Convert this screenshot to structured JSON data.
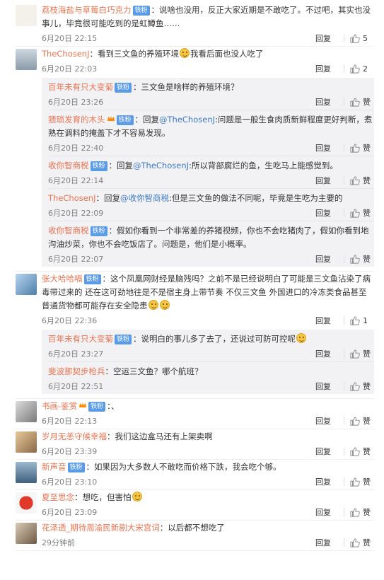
{
  "colors": {
    "name": "#eb7350",
    "mention": "#3d79c4",
    "meta": "#808080",
    "sub_bg": "#f2f2f5",
    "badge": "#5a9be6",
    "vip": "#ff8200"
  },
  "labels": {
    "reply": "回复",
    "like_icon": "thumb-up-icon",
    "verified_badge": "铁粉"
  },
  "comments": [
    {
      "name": "荔枝海盐与草莓白巧克力",
      "badge": "铁粉",
      "text": "：说啥也没用，反正大家近期是不敢吃了。不过吧，其实也没事儿，毕竟很可能吃到的是虹鳟鱼……",
      "time": "6月20日 22:15",
      "reply": "回复",
      "likes": "5"
    },
    {
      "name": "TheChosenJ",
      "text": "：看到三文鱼的养殖环境",
      "text2": "我看后面也没人吃了",
      "time": "6月20日 22:03",
      "reply": "回复",
      "likes": "2",
      "subs": [
        {
          "name": "百年未有只大变菊",
          "badge": "铁粉",
          "text": "：三文鱼是啥样的养殖环境？",
          "time": "6月20日 23:26",
          "reply": "回复",
          "likes": "赞"
        },
        {
          "name": "猥琐发育的木头",
          "badge": "铁粉",
          "pre": "：回复",
          "at": "@TheChosenJ",
          "text": ":问题是一般生食肉质新鲜程度更好判断，煮熟在调料的掩盖下才不容易发现。",
          "time": "6月20日 22:40",
          "reply": "回复",
          "likes": "赞"
        },
        {
          "name": "收你智商税",
          "badge": "铁粉",
          "pre": "：回复",
          "at": "@TheChosenJ",
          "text": ":所以背部腐烂的鱼，生吃马上能感觉到。",
          "time": "6月20日 22:14",
          "reply": "回复",
          "likes": "赞"
        },
        {
          "name": "TheChosenJ",
          "pre": "：回复",
          "at": "@收你智商税",
          "text": ":但是三文鱼的做法不同呢，毕竟是生吃为主要的",
          "time": "6月20日 22:09",
          "reply": "回复",
          "likes": "赞"
        },
        {
          "name": "收你智商税",
          "badge": "铁粉",
          "text": "：假如你看到一个非常差的养猪视频，你也不会吃猪肉了，假如你看到地沟油炒菜，你也不会吃饭店了。问题是，他们是小概率。",
          "time": "6月20日 22:07",
          "reply": "回复",
          "likes": "赞"
        }
      ]
    },
    {
      "name": "张大哈哈嗝",
      "badge": "铁粉",
      "text": "：这个凤凰网财经是脑残吗？之前不是已经说明白了可能是三文鱼沾染了病毒带过来的 还在这可劲地往是不是宿主身上带节奏 不仅三文鱼 外国进口的冷冻类食品甚至普通货物都可能存在安全隐患",
      "time": "6月20日 22:36",
      "reply": "回复",
      "likes": "1",
      "subs": [
        {
          "name": "百年未有只大变菊",
          "badge": "铁粉",
          "text": "：说明白的事儿多了去了，还说过可防可控呢",
          "time": "6月20日 23:27",
          "reply": "回复",
          "likes": "赞"
        },
        {
          "name": "斐波那契步枪兵",
          "text": "：空运三文鱼？哪个航班？",
          "time": "6月20日 22:51",
          "reply": "回复",
          "likes": "赞"
        }
      ]
    },
    {
      "name": "书画-鉴赏",
      "badge": "铁粉",
      "text": "：、",
      "time": "6月20日 22:13",
      "reply": "回复",
      "likes": "赞"
    },
    {
      "name": "岁月无恙守候幸福",
      "text": "：我们这边盒马还有上架卖啊",
      "time": "6月20日 23:39",
      "reply": "回复",
      "likes": "赞"
    },
    {
      "name": "新声音",
      "badge": "铁粉",
      "text": "：如果因为大多数人不敢吃而价格下跌，我会吃个够。",
      "time": "6月20日 23:10",
      "reply": "回复",
      "likes": "赞"
    },
    {
      "name": "夏至思念",
      "text": "：想吃，但害怕",
      "time": "6月20日 23:09",
      "reply": "回复",
      "likes": "赞"
    },
    {
      "name": "花泽透_期待周渝民新剧大宋宫词",
      "text": "：以后都不想吃了",
      "time": "29分钟前",
      "reply": "回复",
      "likes": "赞"
    }
  ]
}
